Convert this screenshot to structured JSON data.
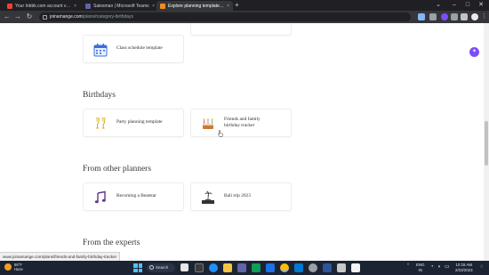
{
  "browser": {
    "tabs": [
      {
        "label": "Your Inbbk.com account verificati...",
        "favicon_color": "#ea4335",
        "active": false
      },
      {
        "label": "Salesman | Microsoft Teams",
        "favicon_color": "#6264a7",
        "active": false
      },
      {
        "label": "Explore planning templates | An...",
        "favicon_color": "#f28b20",
        "active": true
      }
    ],
    "new_tab": "+",
    "tab_close": "×",
    "url_host": "joinamange.com",
    "url_path": "/plans#category-birthdays"
  },
  "page": {
    "top_cards": [
      {
        "label": "Class schedule template",
        "icon": "calendar-icon"
      }
    ],
    "sections": [
      {
        "title": "Birthdays",
        "cards": [
          {
            "label": "Party planning template",
            "icon": "champagne-icon"
          },
          {
            "label": "Friends and family birthday tracker",
            "label_line1": "Friends and family",
            "label_line2": "birthday tracker",
            "icon": "cake-icon"
          }
        ]
      },
      {
        "title": "From other planners",
        "cards": [
          {
            "label": "Becoming a Beatstar",
            "icon": "music-note-icon"
          },
          {
            "label": "Bali trip 2023",
            "icon": "island-icon"
          }
        ]
      },
      {
        "title": "From the experts",
        "cards": []
      }
    ],
    "accent_color": "#7c4dff"
  },
  "status_url": "www.joinamange.com/plans/friends-and-family-birthday-tracker",
  "taskbar": {
    "weather_temp": "66°F",
    "weather_desc": "Haze",
    "search_label": "Search",
    "lang_line1": "ENG",
    "lang_line2": "IN",
    "time": "10:15 AM",
    "date": "2/23/2023"
  }
}
